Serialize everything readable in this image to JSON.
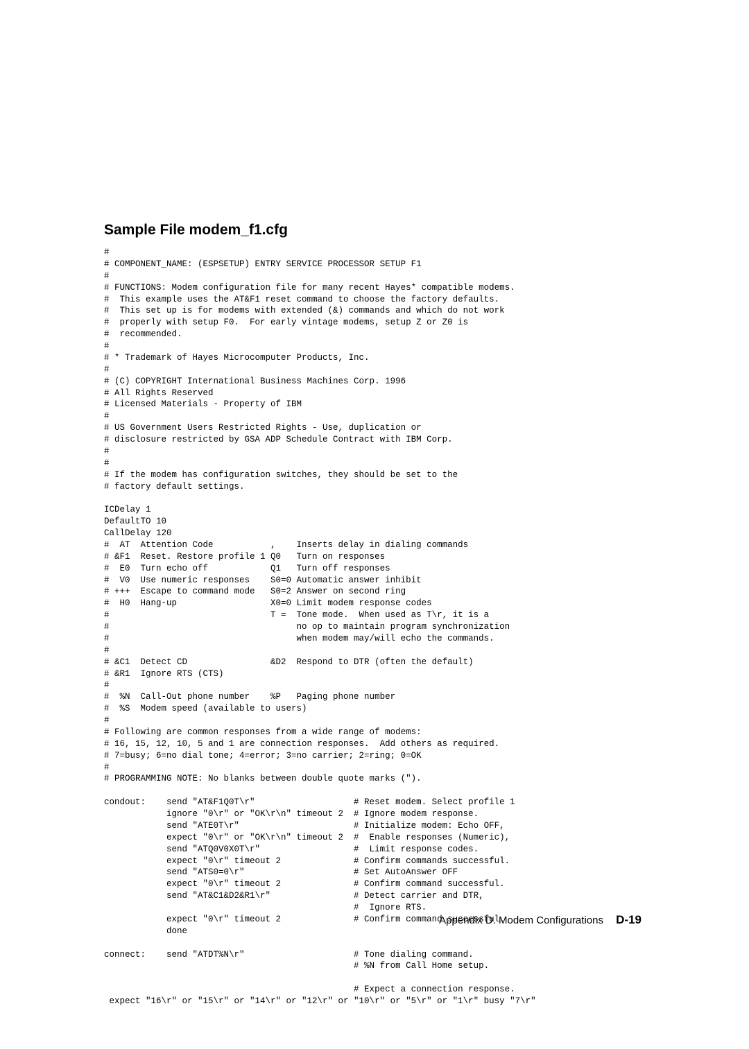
{
  "heading": "Sample File modem_f1.cfg",
  "code": "#\n# COMPONENT_NAME: (ESPSETUP) ENTRY SERVICE PROCESSOR SETUP F1\n#\n# FUNCTIONS: Modem configuration file for many recent Hayes* compatible modems.\n#  This example uses the AT&F1 reset command to choose the factory defaults.\n#  This set up is for modems with extended (&) commands and which do not work\n#  properly with setup F0.  For early vintage modems, setup Z or Z0 is\n#  recommended.\n#\n# * Trademark of Hayes Microcomputer Products, Inc.\n#\n# (C) COPYRIGHT International Business Machines Corp. 1996\n# All Rights Reserved\n# Licensed Materials - Property of IBM\n#\n# US Government Users Restricted Rights - Use, duplication or\n# disclosure restricted by GSA ADP Schedule Contract with IBM Corp.\n#\n#\n# If the modem has configuration switches, they should be set to the\n# factory default settings.\n\nICDelay 1\nDefaultTO 10\nCallDelay 120\n#  AT  Attention Code           ,    Inserts delay in dialing commands\n# &F1  Reset. Restore profile 1 Q0   Turn on responses\n#  E0  Turn echo off            Q1   Turn off responses\n#  V0  Use numeric responses    S0=0 Automatic answer inhibit\n# +++  Escape to command mode   S0=2 Answer on second ring\n#  H0  Hang-up                  X0=0 Limit modem response codes\n#                               T =  Tone mode.  When used as T\\r, it is a\n#                                    no op to maintain program synchronization\n#                                    when modem may/will echo the commands.\n#\n# &C1  Detect CD                &D2  Respond to DTR (often the default)\n# &R1  Ignore RTS (CTS)\n#\n#  %N  Call-Out phone number    %P   Paging phone number\n#  %S  Modem speed (available to users)\n#\n# Following are common responses from a wide range of modems:\n# 16, 15, 12, 10, 5 and 1 are connection responses.  Add others as required.\n# 7=busy; 6=no dial tone; 4=error; 3=no carrier; 2=ring; 0=OK\n#\n# PROGRAMMING NOTE: No blanks between double quote marks (\").\n\ncondout:    send \"AT&F1Q0T\\r\"                   # Reset modem. Select profile 1\n            ignore \"0\\r\" or \"OK\\r\\n\" timeout 2  # Ignore modem response.\n            send \"ATE0T\\r\"                      # Initialize modem: Echo OFF,\n            expect \"0\\r\" or \"OK\\r\\n\" timeout 2  #  Enable responses (Numeric),\n            send \"ATQ0V0X0T\\r\"                  #  Limit response codes.\n            expect \"0\\r\" timeout 2              # Confirm commands successful.\n            send \"ATS0=0\\r\"                     # Set AutoAnswer OFF\n            expect \"0\\r\" timeout 2              # Confirm command successful.\n            send \"AT&C1&D2&R1\\r\"                # Detect carrier and DTR,\n                                                #  Ignore RTS.\n            expect \"0\\r\" timeout 2              # Confirm command successful.\n            done\n\nconnect:    send \"ATDT%N\\r\"                     # Tone dialing command.\n                                                # %N from Call Home setup.\n\n                                                # Expect a connection response.\n expect \"16\\r\" or \"15\\r\" or \"14\\r\" or \"12\\r\" or \"10\\r\" or \"5\\r\" or \"1\\r\" busy \"7\\r\"",
  "footer_text": "Appendix D.  Modem Configurations",
  "footer_page": "D-19"
}
